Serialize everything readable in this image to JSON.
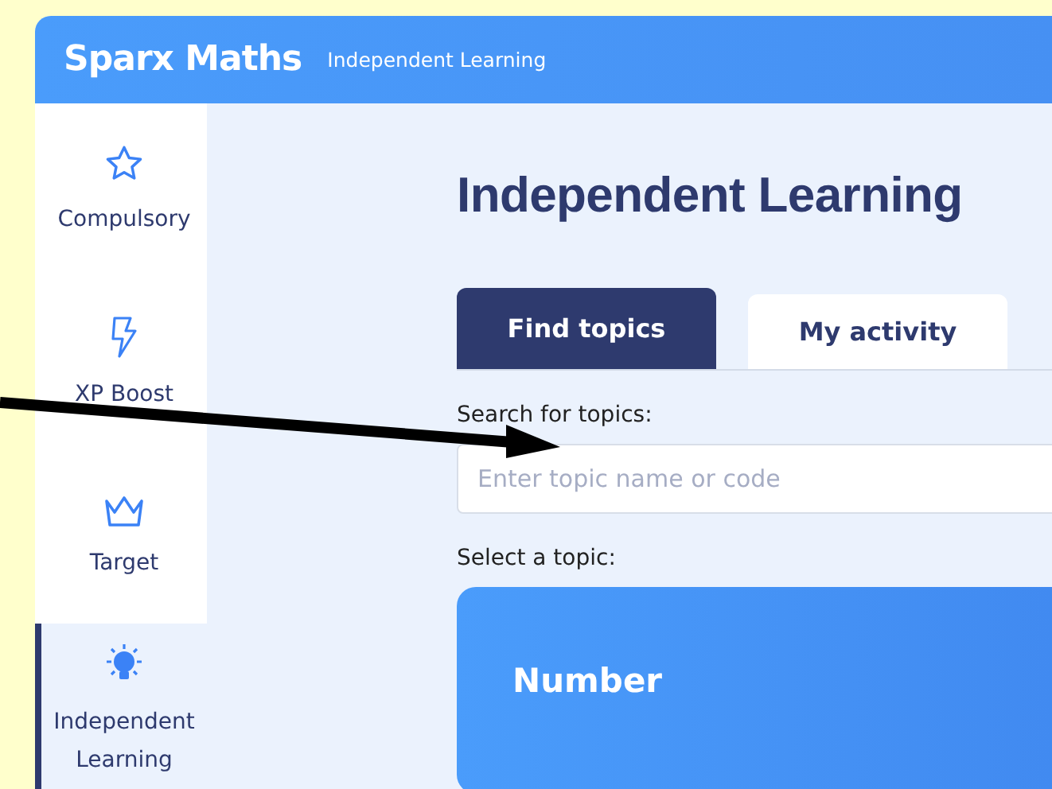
{
  "header": {
    "logo": "Sparx Maths",
    "subtitle": "Independent Learning"
  },
  "sidebar": {
    "items": [
      {
        "label": "Compulsory",
        "kind": "compulsory",
        "selected": false
      },
      {
        "label": "XP Boost",
        "kind": "boost",
        "selected": false
      },
      {
        "label": "Target",
        "kind": "target",
        "selected": false
      },
      {
        "label": "Independent Learning",
        "kind": "independent",
        "selected": true
      }
    ]
  },
  "main": {
    "title": "Independent Learning",
    "tabs": [
      {
        "label": "Find topics",
        "selected": true
      },
      {
        "label": "My activity",
        "selected": false
      }
    ],
    "search": {
      "label": "Search for topics:",
      "placeholder": "Enter topic name or code"
    },
    "select_label": "Select a topic:",
    "topics": [
      {
        "name": "Number"
      }
    ]
  }
}
